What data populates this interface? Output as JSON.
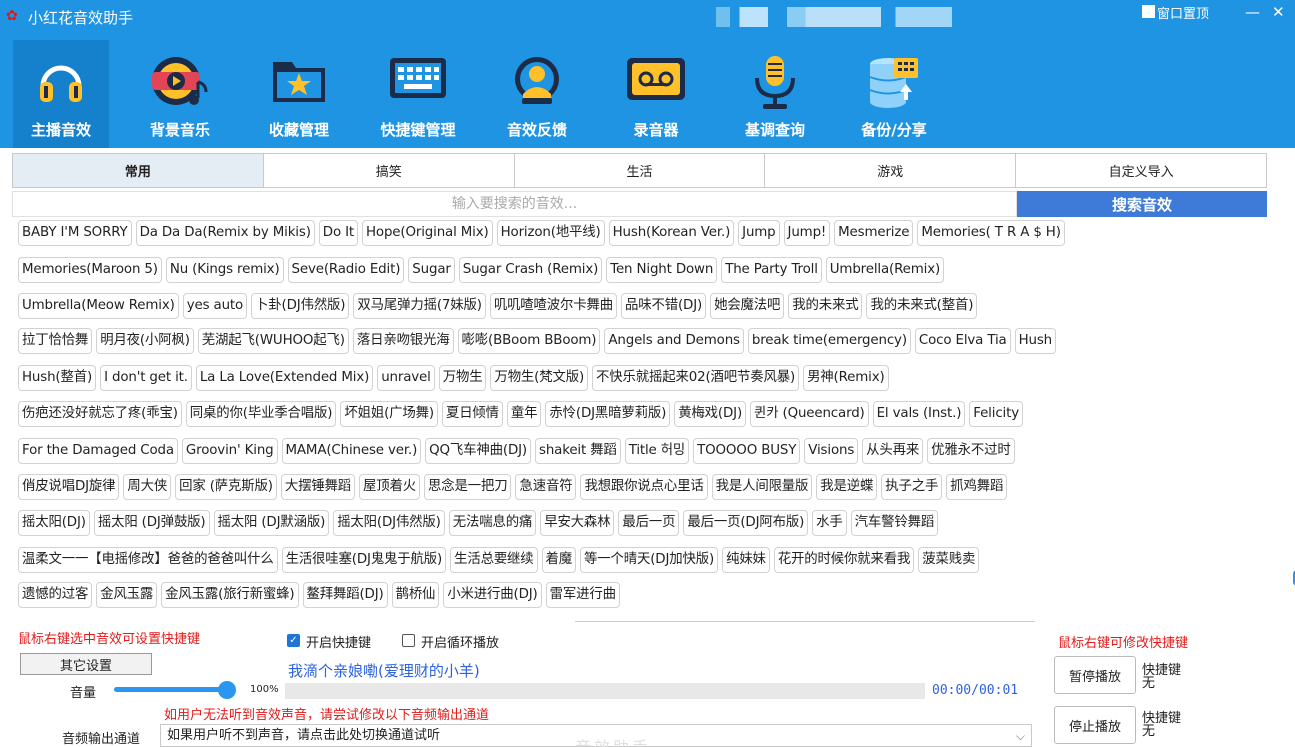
{
  "window": {
    "title": "小红花音效助手",
    "pin_label": "窗口置顶",
    "minimize": "—",
    "close": "✕"
  },
  "nav": [
    {
      "label": "主播音效",
      "icon": "headphones-icon",
      "active": true
    },
    {
      "label": "背景音乐",
      "icon": "music-disc-icon",
      "active": false
    },
    {
      "label": "收藏管理",
      "icon": "star-folder-icon",
      "active": false
    },
    {
      "label": "快捷键管理",
      "icon": "keyboard-icon",
      "active": false
    },
    {
      "label": "音效反馈",
      "icon": "feedback-person-icon",
      "active": false
    },
    {
      "label": "录音器",
      "icon": "tape-icon",
      "active": false
    },
    {
      "label": "基调查询",
      "icon": "microphone-icon",
      "active": false
    },
    {
      "label": "备份/分享",
      "icon": "database-backup-icon",
      "active": false
    }
  ],
  "tabs": [
    "常用",
    "搞笑",
    "生活",
    "游戏",
    "自定义导入"
  ],
  "search": {
    "placeholder": "输入要搜索的音效...",
    "button": "搜索音效"
  },
  "effects": [
    [
      "BABY I'M SORRY",
      "Da Da Da(Remix by Mikis)",
      "Do It",
      "Hope(Original Mix)",
      "Horizon(地平线)",
      "Hush(Korean Ver.)",
      "Jump",
      "Jump!",
      "Mesmerize",
      "Memories( T R A $ H)"
    ],
    [
      "Memories(Maroon 5)",
      "Nu (Kings remix)",
      "Seve(Radio Edit)",
      "Sugar",
      "Sugar Crash (Remix)",
      "Ten Night Down",
      "The Party Troll",
      "Umbrella(Remix)"
    ],
    [
      "Umbrella(Meow Remix)",
      "yes auto",
      "卜卦(DJ伟然版)",
      "双马尾弹力摇(7妹版)",
      "叽叽喳喳波尔卡舞曲",
      "品味不错(DJ)",
      "她会魔法吧",
      "我的未来式",
      "我的未来式(整首)"
    ],
    [
      "拉丁恰恰舞",
      "明月夜(小阿枫)",
      "芜湖起飞(WUHOO起飞)",
      "落日亲吻银光海",
      "嘭嘭(BBoom BBoom)",
      "Angels and Demons",
      "break time(emergency)",
      "Coco Elva Tia",
      "Hush"
    ],
    [
      "Hush(整首)",
      "I don't get it.",
      "La La Love(Extended Mix)",
      "unravel",
      "万物生",
      "万物生(梵文版)",
      "不快乐就摇起来02(酒吧节奏风暴)",
      "男神(Remix)"
    ],
    [
      "伤疤还没好就忘了疼(乖宝)",
      "同桌的你(毕业季合唱版)",
      "坏姐姐(广场舞)",
      "夏日倾情",
      "童年",
      "赤怜(DJ黑暗萝莉版)",
      "黄梅戏(DJ)",
      "퀸카 (Queencard)",
      "El vals (Inst.)",
      "Felicity"
    ],
    [
      "For the Damaged Coda",
      "Groovin' King",
      "MAMA(Chinese ver.)",
      "QQ飞车神曲(DJ)",
      "shakeit 舞蹈",
      "Title 허밍",
      "TOOOOO BUSY",
      "Visions",
      "从头再来",
      "优雅永不过时"
    ],
    [
      "俏皮说唱DJ旋律",
      "周大侠",
      "回家 (萨克斯版)",
      "大摆锤舞蹈",
      "屋顶着火",
      "思念是一把刀",
      "急速音符",
      "我想跟你说点心里话",
      "我是人间限量版",
      "我是逆蝶",
      "执子之手",
      "抓鸡舞蹈"
    ],
    [
      "摇太阳(DJ)",
      "摇太阳 (DJ弹鼓版)",
      "摇太阳 (DJ默涵版)",
      "摇太阳(DJ伟然版)",
      "无法喘息的痛",
      "早安大森林",
      "最后一页",
      "最后一页(DJ阿布版)",
      "水手",
      "汽车警铃舞蹈"
    ],
    [
      "温柔文一一【电摇修改】爸爸的爸爸叫什么",
      "生活很哇塞(DJ鬼鬼于航版)",
      "生活总要继续",
      "着魔",
      "等一个晴天(DJ加快版)",
      "纯妹妹",
      "花开的时候你就来看我",
      "菠菜贱卖"
    ],
    [
      "遗憾的过客",
      "金风玉露",
      "金风玉露(旅行新蜜蜂)",
      "鳌拜舞蹈(DJ)",
      "鹊桥仙",
      "小米进行曲(DJ)",
      "雷军进行曲"
    ]
  ],
  "bottom": {
    "hint_right_click": "鼠标右键选中音效可设置快捷键",
    "hint_modify": "鼠标右键可修改快捷键",
    "enable_shortcut": "开启快捷键",
    "enable_loop": "开启循环播放",
    "other_settings": "其它设置",
    "now_playing": "我滴个亲娘嘞(爱理财的小羊)",
    "volume_label": "音量",
    "volume_value": "100%",
    "volume_level": 1.0,
    "time": "00:00/00:01",
    "pause": "暂停播放",
    "stop": "停止播放",
    "shortcut_title": "快捷键",
    "shortcut_none": "无",
    "output_hint": "如用户无法听到音效声音，请尝试修改以下音频输出通道",
    "output_label": "音频输出通道",
    "output_value": "如果用户听不到声音，请点击此处切换通道试听",
    "watermark": "音效助手"
  }
}
